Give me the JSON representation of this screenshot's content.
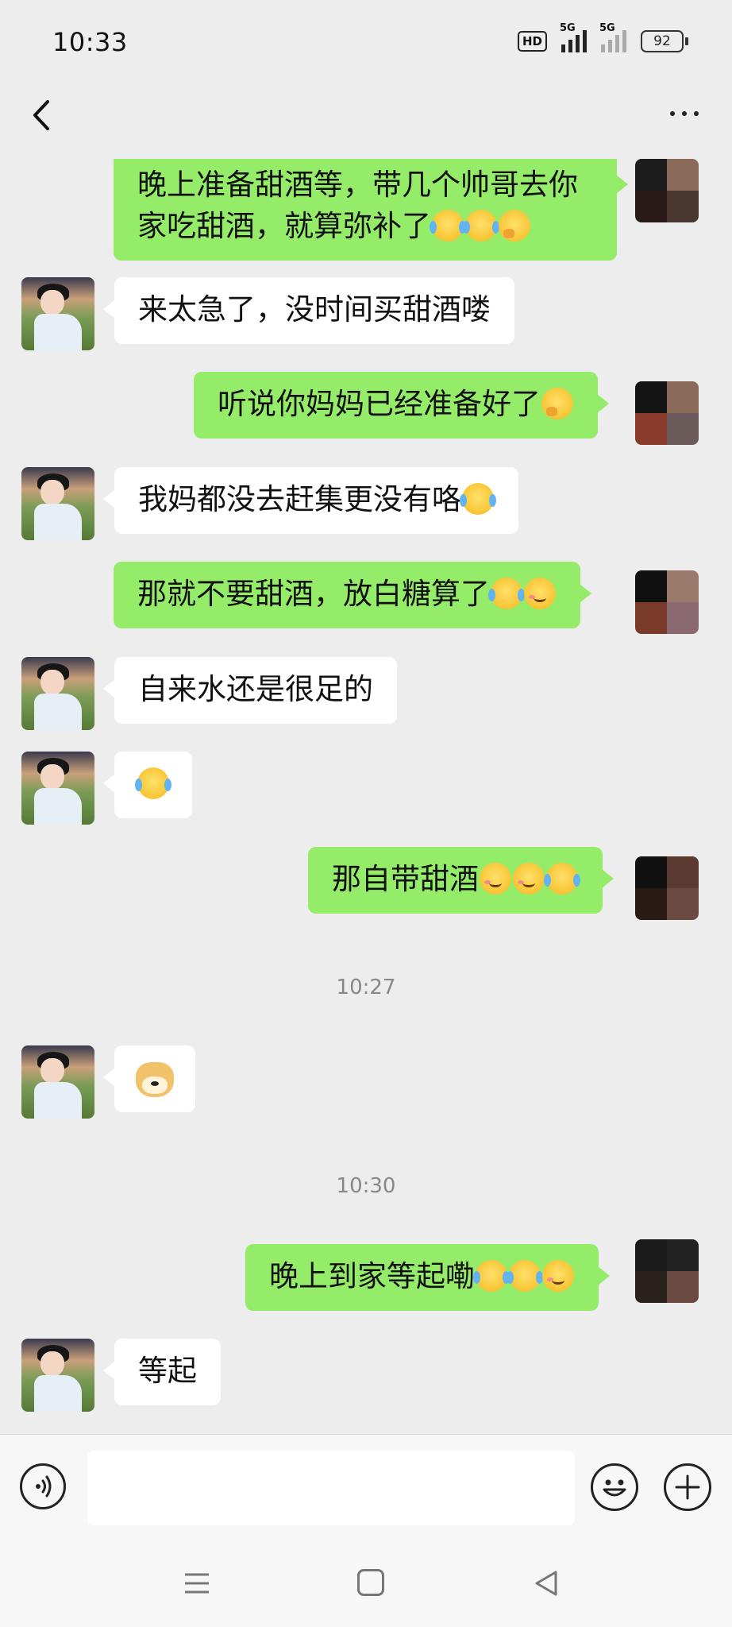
{
  "status_bar": {
    "time": "10:33",
    "hd_label": "HD",
    "signal1_label": "5G",
    "signal2_label": "5G",
    "battery": "92"
  },
  "header": {
    "title": "",
    "title_blurred": true
  },
  "messages": [
    {
      "side": "me",
      "segments": [
        {
          "t": "晚上准备甜酒等，带几个帅哥去你家吃甜酒，就算弥补了"
        },
        {
          "emoji": "cry"
        },
        {
          "emoji": "cry"
        },
        {
          "emoji": "think"
        }
      ]
    },
    {
      "side": "them",
      "segments": [
        {
          "t": "来太急了，没时间买甜酒喽"
        }
      ]
    },
    {
      "side": "me",
      "segments": [
        {
          "t": "听说你妈妈已经准备好了"
        },
        {
          "emoji": "think"
        }
      ]
    },
    {
      "side": "them",
      "segments": [
        {
          "t": "我妈都没去赶集更没有咯"
        },
        {
          "emoji": "cry"
        }
      ]
    },
    {
      "side": "me",
      "segments": [
        {
          "t": "那就不要甜酒，放白糖算了"
        },
        {
          "emoji": "cry"
        },
        {
          "emoji": "smile"
        }
      ]
    },
    {
      "side": "them",
      "segments": [
        {
          "t": "自来水还是很足的"
        }
      ]
    },
    {
      "side": "them",
      "segments": [
        {
          "emoji": "cry"
        }
      ]
    },
    {
      "side": "me",
      "segments": [
        {
          "t": "那自带甜酒"
        },
        {
          "emoji": "smile"
        },
        {
          "emoji": "smile"
        },
        {
          "emoji": "cry"
        }
      ]
    },
    {
      "timestamp": "10:27"
    },
    {
      "side": "them",
      "segments": [
        {
          "emoji": "doge"
        }
      ]
    },
    {
      "timestamp": "10:30"
    },
    {
      "side": "me",
      "segments": [
        {
          "t": "晚上到家等起嘞"
        },
        {
          "emoji": "cry"
        },
        {
          "emoji": "cry"
        },
        {
          "emoji": "smile"
        }
      ]
    },
    {
      "side": "them",
      "segments": [
        {
          "t": "等起"
        }
      ]
    }
  ],
  "colors": {
    "me_bubble": "#95ec69",
    "them_bubble": "#ffffff",
    "background": "#ededed"
  },
  "input": {
    "value": "",
    "placeholder": ""
  },
  "icons": {
    "voice": "voice-icon",
    "emoji": "emoji-icon",
    "plus": "plus-icon",
    "back": "back-arrow-icon",
    "more": "more-icon"
  }
}
